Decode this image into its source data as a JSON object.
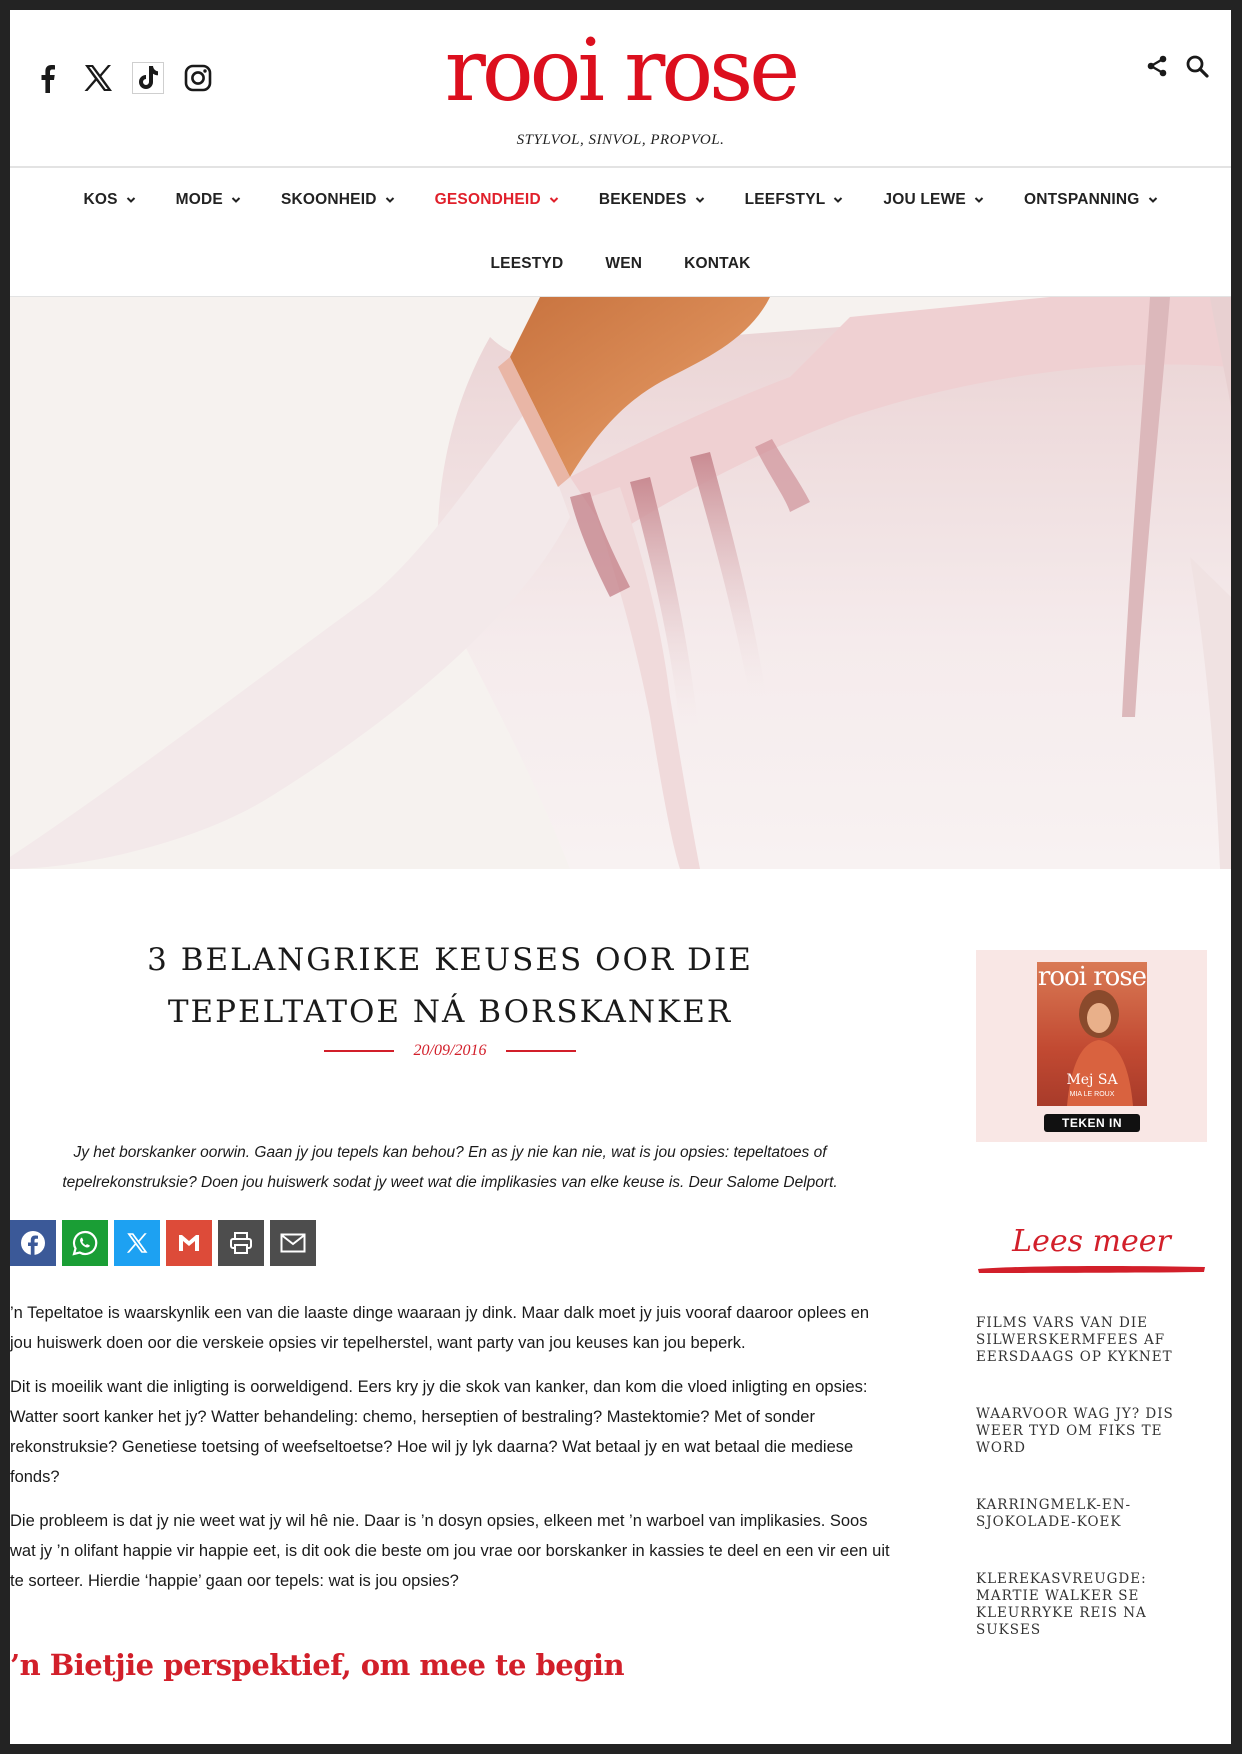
{
  "brand": {
    "logo_text": "rooi rose",
    "tagline": "STYLVOL, SINVOL, PROPVOL.",
    "accent_color": "#dc0f1e"
  },
  "social_icons": [
    "facebook-icon",
    "x-icon",
    "tiktok-icon",
    "instagram-icon"
  ],
  "header_tools": [
    "share-icon",
    "search-icon"
  ],
  "nav": {
    "row1": [
      {
        "label": "KOS",
        "dropdown": true
      },
      {
        "label": "MODE",
        "dropdown": true
      },
      {
        "label": "SKOONHEID",
        "dropdown": true
      },
      {
        "label": "GESONDHEID",
        "dropdown": true,
        "active": true
      },
      {
        "label": "BEKENDES",
        "dropdown": true
      },
      {
        "label": "LEEFSTYL",
        "dropdown": true
      },
      {
        "label": "JOU LEWE",
        "dropdown": true
      },
      {
        "label": "ONTSPANNING",
        "dropdown": true
      }
    ],
    "row2": [
      {
        "label": "LEESTYD"
      },
      {
        "label": "WEN"
      },
      {
        "label": "KONTAK"
      }
    ]
  },
  "article": {
    "title": "3 BELANGRIKE KEUSES OOR DIE TEPELTATOE NÁ BORSKANKER",
    "date": "20/09/2016",
    "intro": "Jy het borskanker oorwin. Gaan jy jou tepels kan behou? En as jy nie kan nie, wat is jou opsies: tepeltatoes of tepelrekonstruksie? Doen jou huiswerk sodat jy weet wat die implikasies van elke keuse is. Deur Salome Delport.",
    "share_buttons": [
      {
        "icon": "facebook-icon",
        "color": "#3b5998"
      },
      {
        "icon": "whatsapp-icon",
        "color": "#1a9e35"
      },
      {
        "icon": "x-icon",
        "color": "#1da1f2"
      },
      {
        "icon": "gmail-icon",
        "color": "#dd4b39"
      },
      {
        "icon": "print-icon",
        "color": "#4d4d4d"
      },
      {
        "icon": "email-icon",
        "color": "#4d4d4d"
      }
    ],
    "paragraphs": [
      "’n Tepeltatoe is waarskynlik een van die laaste dinge waaraan jy dink. Maar dalk moet jy juis vooraf daaroor oplees en jou huiswerk doen oor die verskeie opsies vir tepelherstel, want party van jou keuses kan jou beperk.",
      "Dit is moeilik want die inligting is oorweldigend. Eers kry jy die skok van kanker, dan kom die vloed inligting en opsies: Watter soort kanker het jy? Watter behandeling: chemo, herseptien of bestraling? Mastektomie? Met of sonder rekonstruksie? Genetiese toetsing of weefseltoetse? Hoe wil jy lyk daarna? Wat betaal jy en wat betaal die mediese fonds?",
      "Die probleem is dat jy nie weet wat jy wil hê nie. Daar is ’n dosyn opsies, elkeen met ’n warboel van implikasies. Soos wat jy ’n olifant happie vir happie eet, is dit ook die beste om jou vrae oor borskanker in kassies te deel en een vir een uit te sorteer. Hierdie ‘happie’ gaan oor tepels: wat is jou opsies?"
    ],
    "subheading": "’n Bietjie perspektief, om mee te begin"
  },
  "sidebar": {
    "promo": {
      "cover_logo": "rooi rose",
      "cover_name": "Mej SA",
      "cover_sub": "MIA LE ROUX",
      "button_label": "TEKEN IN"
    },
    "more_title": "Lees meer",
    "more_items": [
      "FILMS VARS VAN DIE SILWERSKERMFEES AF EERSDAAGS OP KYKNET",
      "WAARVOOR WAG JY? DIS WEER TYD OM FIKS TE WORD",
      "KARRINGMELK-EN-SJOKOLADE-KOEK",
      "KLEREKASVREUGDE: MARTIE WALKER SE KLEURRYKE REIS NA SUKSES"
    ]
  }
}
